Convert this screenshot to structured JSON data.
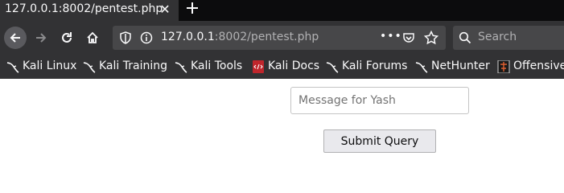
{
  "tab": {
    "title": "127.0.0.1:8002/pentest.php",
    "close_icon": "close-icon"
  },
  "toolbar": {
    "new_tab_icon": "plus-icon",
    "back_icon": "arrow-left-icon",
    "forward_icon": "arrow-right-icon",
    "reload_icon": "reload-icon",
    "home_icon": "home-icon"
  },
  "urlbar": {
    "host": "127.0.0.1",
    "rest": ":8002/pentest.php",
    "more": "•••"
  },
  "search": {
    "placeholder": "Search"
  },
  "bookmarks": [
    {
      "label": "Kali Linux",
      "icon": "kali-dragon-icon"
    },
    {
      "label": "Kali Training",
      "icon": "kali-dragon-icon"
    },
    {
      "label": "Kali Tools",
      "icon": "kali-dragon-icon"
    },
    {
      "label": "Kali Docs",
      "icon": "kali-docs-icon"
    },
    {
      "label": "Kali Forums",
      "icon": "kali-dragon-icon"
    },
    {
      "label": "NetHunter",
      "icon": "kali-dragon-icon"
    },
    {
      "label": "Offensive",
      "icon": "offensive-security-icon"
    }
  ],
  "form": {
    "message_placeholder": "Message for Yash",
    "message_value": "",
    "submit_label": "Submit Query"
  },
  "colors": {
    "toolbar_bg": "#323234",
    "tabstrip_bg": "#0c0c0d",
    "urlbar_bg": "#474749",
    "docs_icon_red": "#c0262c"
  }
}
